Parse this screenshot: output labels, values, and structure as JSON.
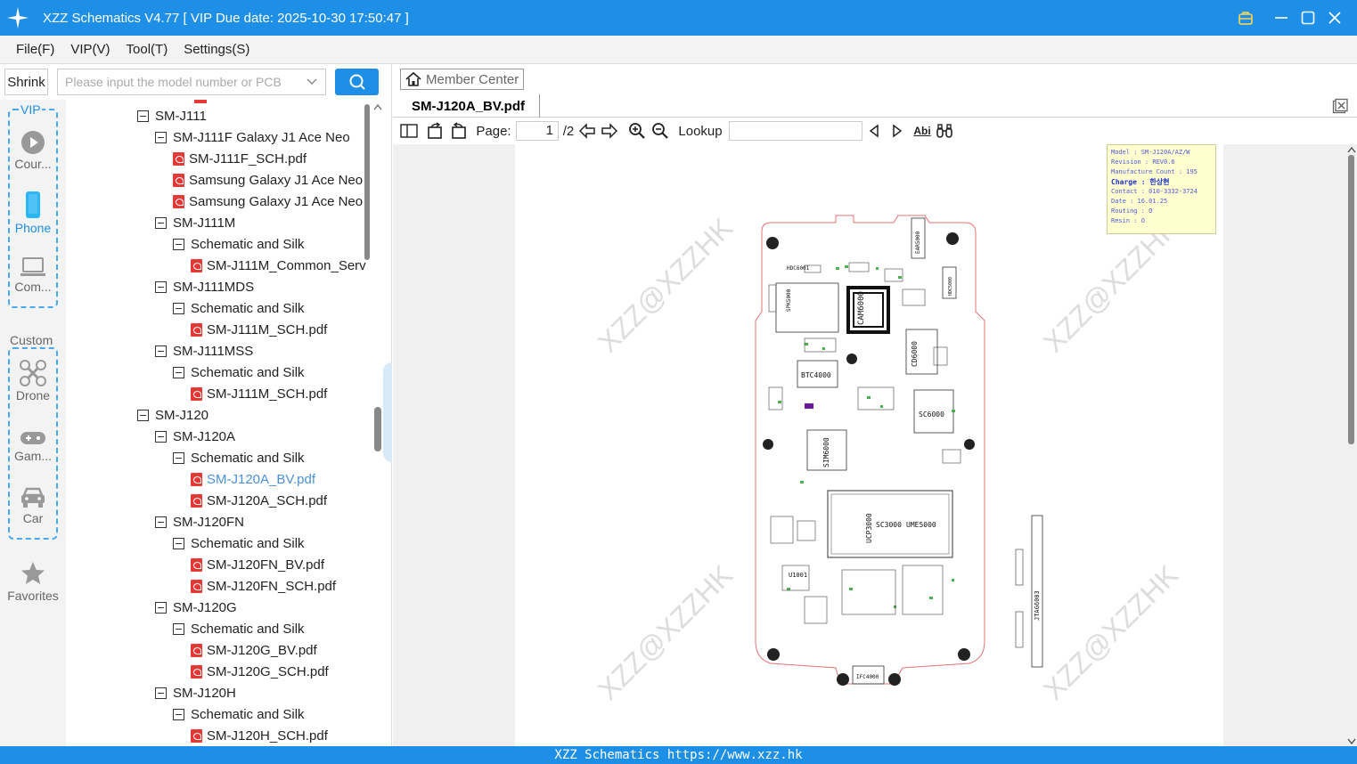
{
  "window": {
    "title": "XZZ Schematics V4.77 [ VIP Due date: 2025-10-30 17:50:47 ]"
  },
  "menu": [
    "File(F)",
    "VIP(V)",
    "Tool(T)",
    "Settings(S)"
  ],
  "search": {
    "shrink_label": "Shrink",
    "placeholder": "Please input the model number or PCB"
  },
  "categories": {
    "vip_label": "VIP",
    "custom_label": "Custom",
    "vip_items": [
      "Cour...",
      "Phone",
      "Com..."
    ],
    "custom_items": [
      "Drone",
      "Gam...",
      "Car"
    ],
    "favorites": "Favorites"
  },
  "tree": [
    {
      "label": "SM-J111",
      "level": 0,
      "type": "folder"
    },
    {
      "label": "SM-J111F Galaxy J1 Ace Neo",
      "level": 1,
      "type": "folder"
    },
    {
      "label": "SM-J111F_SCH.pdf",
      "level": 2,
      "type": "pdf"
    },
    {
      "label": "Samsung Galaxy J1 Ace Neo",
      "level": 2,
      "type": "pdf"
    },
    {
      "label": "Samsung Galaxy J1 Ace Neo",
      "level": 2,
      "type": "pdf"
    },
    {
      "label": "SM-J111M",
      "level": 1,
      "type": "folder"
    },
    {
      "label": "Schematic and Silk",
      "level": 2,
      "type": "folder"
    },
    {
      "label": "SM-J111M_Common_Serv",
      "level": 3,
      "type": "pdf"
    },
    {
      "label": "SM-J111MDS",
      "level": 1,
      "type": "folder"
    },
    {
      "label": "Schematic and Silk",
      "level": 2,
      "type": "folder"
    },
    {
      "label": "SM-J111M_SCH.pdf",
      "level": 3,
      "type": "pdf"
    },
    {
      "label": "SM-J111MSS",
      "level": 1,
      "type": "folder"
    },
    {
      "label": "Schematic and Silk",
      "level": 2,
      "type": "folder"
    },
    {
      "label": "SM-J111M_SCH.pdf",
      "level": 3,
      "type": "pdf"
    },
    {
      "label": "SM-J120",
      "level": 0,
      "type": "folder"
    },
    {
      "label": "SM-J120A",
      "level": 1,
      "type": "folder"
    },
    {
      "label": "Schematic and Silk",
      "level": 2,
      "type": "folder"
    },
    {
      "label": "SM-J120A_BV.pdf",
      "level": 3,
      "type": "pdf",
      "selected": true
    },
    {
      "label": "SM-J120A_SCH.pdf",
      "level": 3,
      "type": "pdf"
    },
    {
      "label": "SM-J120FN",
      "level": 1,
      "type": "folder"
    },
    {
      "label": "Schematic and Silk",
      "level": 2,
      "type": "folder"
    },
    {
      "label": "SM-J120FN_BV.pdf",
      "level": 3,
      "type": "pdf"
    },
    {
      "label": "SM-J120FN_SCH.pdf",
      "level": 3,
      "type": "pdf"
    },
    {
      "label": "SM-J120G",
      "level": 1,
      "type": "folder"
    },
    {
      "label": "Schematic and Silk",
      "level": 2,
      "type": "folder"
    },
    {
      "label": "SM-J120G_BV.pdf",
      "level": 3,
      "type": "pdf"
    },
    {
      "label": "SM-J120G_SCH.pdf",
      "level": 3,
      "type": "pdf"
    },
    {
      "label": "SM-J120H",
      "level": 1,
      "type": "folder"
    },
    {
      "label": "Schematic and Silk",
      "level": 2,
      "type": "folder"
    },
    {
      "label": "SM-J120H_SCH.pdf",
      "level": 3,
      "type": "pdf"
    }
  ],
  "viewer": {
    "member_center": "Member Center",
    "tab_title": "SM-J120A_BV.pdf",
    "page_label": "Page:",
    "page_current": "1",
    "page_total": "/2",
    "lookup_label": "Lookup",
    "match_case_icon_text": "Abi"
  },
  "document": {
    "info_lines": [
      "Model : SM-J120A/AZ/W",
      "Revision : REV0.6",
      "Manufacture Count : 195",
      "Charge : 한상현",
      "Contact : 010-3332-3724",
      "Date : 16.01.25",
      "Routing : O",
      "Resin : O"
    ],
    "watermark": "XZZ@XZZHK",
    "components": [
      "HDC6001",
      "SPK5000",
      "CAM6000",
      "EAR5000",
      "HDC5000",
      "CD6000",
      "BTC4000",
      "SC6000",
      "SIM6000",
      "UCP3000",
      "SC3000",
      "UME5000",
      "U1001",
      "JTAG6003",
      "IFC4000"
    ]
  },
  "statusbar": "XZZ Schematics https://www.xzz.hk",
  "colors": {
    "accent": "#1e8fe6",
    "selected_text": "#4a90d9",
    "pdf_icon": "#e53935"
  }
}
